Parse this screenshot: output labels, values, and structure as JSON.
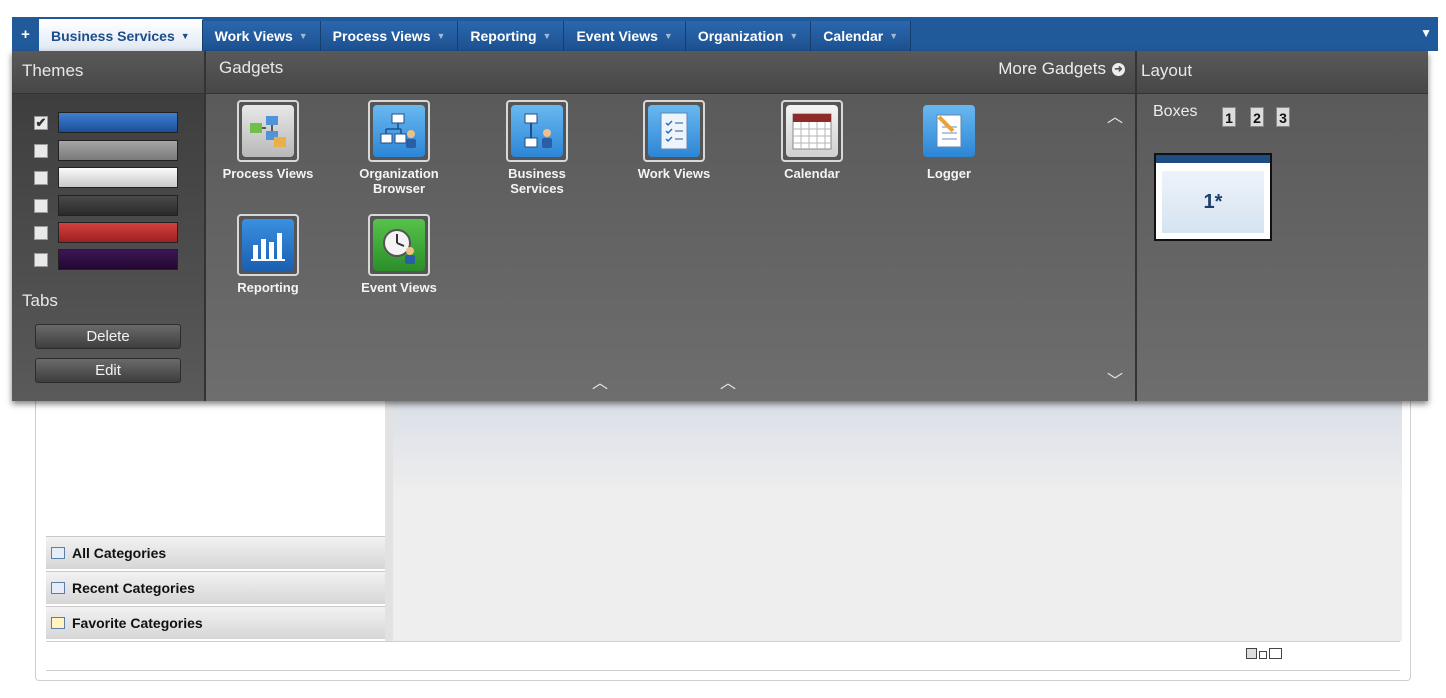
{
  "tabbar": {
    "add_label": "+",
    "tabs": [
      {
        "label": "Business Services",
        "active": true
      },
      {
        "label": "Work Views"
      },
      {
        "label": "Process Views"
      },
      {
        "label": "Reporting"
      },
      {
        "label": "Event Views"
      },
      {
        "label": "Organization"
      },
      {
        "label": "Calendar"
      }
    ],
    "caret": "▼"
  },
  "themes": {
    "title": "Themes",
    "options": [
      {
        "color": "#1f5ba8",
        "checked": true
      },
      {
        "color": "#8a8a8a",
        "checked": false
      },
      {
        "color": "#d9d9d9",
        "checked": false
      },
      {
        "color": "#3b3b3b",
        "checked": false
      },
      {
        "color": "#b62a2a",
        "checked": false
      },
      {
        "color": "#2e0f3f",
        "checked": false
      }
    ],
    "check_mark": "✔"
  },
  "tabs_section": {
    "title": "Tabs",
    "delete_label": "Delete",
    "edit_label": "Edit"
  },
  "gadgets": {
    "title": "Gadgets",
    "more_label": "More Gadgets",
    "items": [
      {
        "label": "Process Views"
      },
      {
        "label": "Organization Browser"
      },
      {
        "label": "Business Services"
      },
      {
        "label": "Work Views"
      },
      {
        "label": "Calendar"
      },
      {
        "label": "Logger"
      },
      {
        "label": "Reporting"
      },
      {
        "label": "Event Views"
      }
    ]
  },
  "layout": {
    "title": "Layout",
    "boxes_label": "Boxes",
    "box_options": [
      "1",
      "2",
      "3"
    ],
    "thumb_label": "1*"
  },
  "categories": {
    "items": [
      {
        "label": "All Categories"
      },
      {
        "label": "Recent Categories"
      },
      {
        "label": "Favorite Categories"
      }
    ]
  }
}
